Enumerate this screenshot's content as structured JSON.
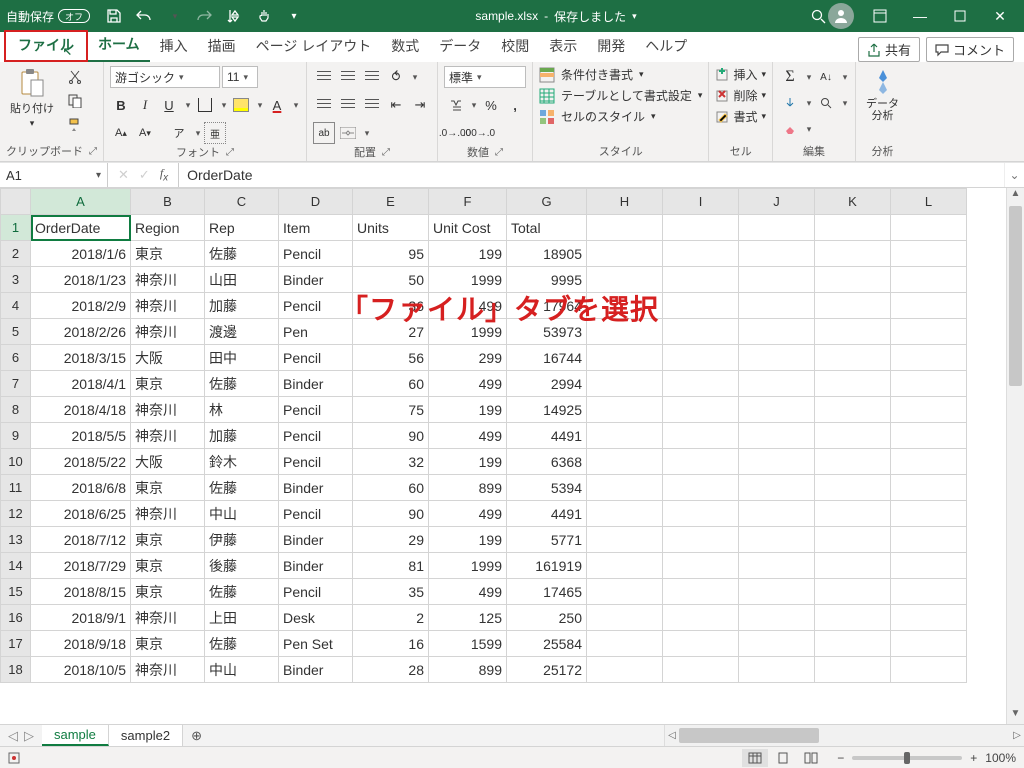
{
  "titlebar": {
    "autosave_label": "自動保存",
    "autosave_state": "オフ",
    "filename": "sample.xlsx",
    "saved_status": "保存しました"
  },
  "tabs": {
    "file": "ファイル",
    "home": "ホーム",
    "insert": "挿入",
    "draw": "描画",
    "pagelayout": "ページ レイアウト",
    "formulas": "数式",
    "data": "データ",
    "review": "校閲",
    "view": "表示",
    "developer": "開発",
    "help": "ヘルプ",
    "share": "共有",
    "comments": "コメント"
  },
  "ribbon": {
    "clipboard": {
      "paste": "貼り付け",
      "label": "クリップボード"
    },
    "font": {
      "name": "游ゴシック",
      "size": "11",
      "ruby": "ア",
      "label": "フォント"
    },
    "alignment": {
      "wrap": "ab",
      "label": "配置"
    },
    "number": {
      "format": "標準",
      "label": "数値"
    },
    "styles": {
      "conditional": "条件付き書式",
      "astable": "テーブルとして書式設定",
      "cellstyles": "セルのスタイル",
      "label": "スタイル"
    },
    "cells": {
      "insert": "挿入",
      "delete": "削除",
      "format": "書式",
      "label": "セル"
    },
    "editing": {
      "label": "編集"
    },
    "analysis": {
      "btn": "データ\n分析",
      "label": "分析"
    }
  },
  "formulabar": {
    "namebox": "A1",
    "formula": "OrderDate"
  },
  "columns": [
    "A",
    "B",
    "C",
    "D",
    "E",
    "F",
    "G",
    "H",
    "I",
    "J",
    "K",
    "L"
  ],
  "headers": {
    "A": "OrderDate",
    "B": "Region",
    "C": "Rep",
    "D": "Item",
    "E": "Units",
    "F": "Unit Cost",
    "G": "Total"
  },
  "rows": [
    {
      "n": 1,
      "kind": "header"
    },
    {
      "n": 2,
      "A": "2018/1/6",
      "B": "東京",
      "C": "佐藤",
      "D": "Pencil",
      "E": "95",
      "F": "199",
      "G": "18905"
    },
    {
      "n": 3,
      "A": "2018/1/23",
      "B": "神奈川",
      "C": "山田",
      "D": "Binder",
      "E": "50",
      "F": "1999",
      "G": "9995"
    },
    {
      "n": 4,
      "A": "2018/2/9",
      "B": "神奈川",
      "C": "加藤",
      "D": "Pencil",
      "E": "36",
      "F": "499",
      "G": "17964"
    },
    {
      "n": 5,
      "A": "2018/2/26",
      "B": "神奈川",
      "C": "渡邊",
      "D": "Pen",
      "E": "27",
      "F": "1999",
      "G": "53973"
    },
    {
      "n": 6,
      "A": "2018/3/15",
      "B": "大阪",
      "C": "田中",
      "D": "Pencil",
      "E": "56",
      "F": "299",
      "G": "16744"
    },
    {
      "n": 7,
      "A": "2018/4/1",
      "B": "東京",
      "C": "佐藤",
      "D": "Binder",
      "E": "60",
      "F": "499",
      "G": "2994"
    },
    {
      "n": 8,
      "A": "2018/4/18",
      "B": "神奈川",
      "C": "林",
      "D": "Pencil",
      "E": "75",
      "F": "199",
      "G": "14925"
    },
    {
      "n": 9,
      "A": "2018/5/5",
      "B": "神奈川",
      "C": "加藤",
      "D": "Pencil",
      "E": "90",
      "F": "499",
      "G": "4491"
    },
    {
      "n": 10,
      "A": "2018/5/22",
      "B": "大阪",
      "C": "鈴木",
      "D": "Pencil",
      "E": "32",
      "F": "199",
      "G": "6368"
    },
    {
      "n": 11,
      "A": "2018/6/8",
      "B": "東京",
      "C": "佐藤",
      "D": "Binder",
      "E": "60",
      "F": "899",
      "G": "5394"
    },
    {
      "n": 12,
      "A": "2018/6/25",
      "B": "神奈川",
      "C": "中山",
      "D": "Pencil",
      "E": "90",
      "F": "499",
      "G": "4491"
    },
    {
      "n": 13,
      "A": "2018/7/12",
      "B": "東京",
      "C": "伊藤",
      "D": "Binder",
      "E": "29",
      "F": "199",
      "G": "5771"
    },
    {
      "n": 14,
      "A": "2018/7/29",
      "B": "東京",
      "C": "後藤",
      "D": "Binder",
      "E": "81",
      "F": "1999",
      "G": "161919"
    },
    {
      "n": 15,
      "A": "2018/8/15",
      "B": "東京",
      "C": "佐藤",
      "D": "Pencil",
      "E": "35",
      "F": "499",
      "G": "17465"
    },
    {
      "n": 16,
      "A": "2018/9/1",
      "B": "神奈川",
      "C": "上田",
      "D": "Desk",
      "E": "2",
      "F": "125",
      "G": "250"
    },
    {
      "n": 17,
      "A": "2018/9/18",
      "B": "東京",
      "C": "佐藤",
      "D": "Pen Set",
      "E": "16",
      "F": "1599",
      "G": "25584"
    },
    {
      "n": 18,
      "A": "2018/10/5",
      "B": "神奈川",
      "C": "中山",
      "D": "Binder",
      "E": "28",
      "F": "899",
      "G": "25172"
    }
  ],
  "sheets": {
    "tab1": "sample",
    "tab2": "sample2"
  },
  "statusbar": {
    "ready": "",
    "zoom": "100%"
  },
  "annotation": "「ファイル」タブを選択"
}
